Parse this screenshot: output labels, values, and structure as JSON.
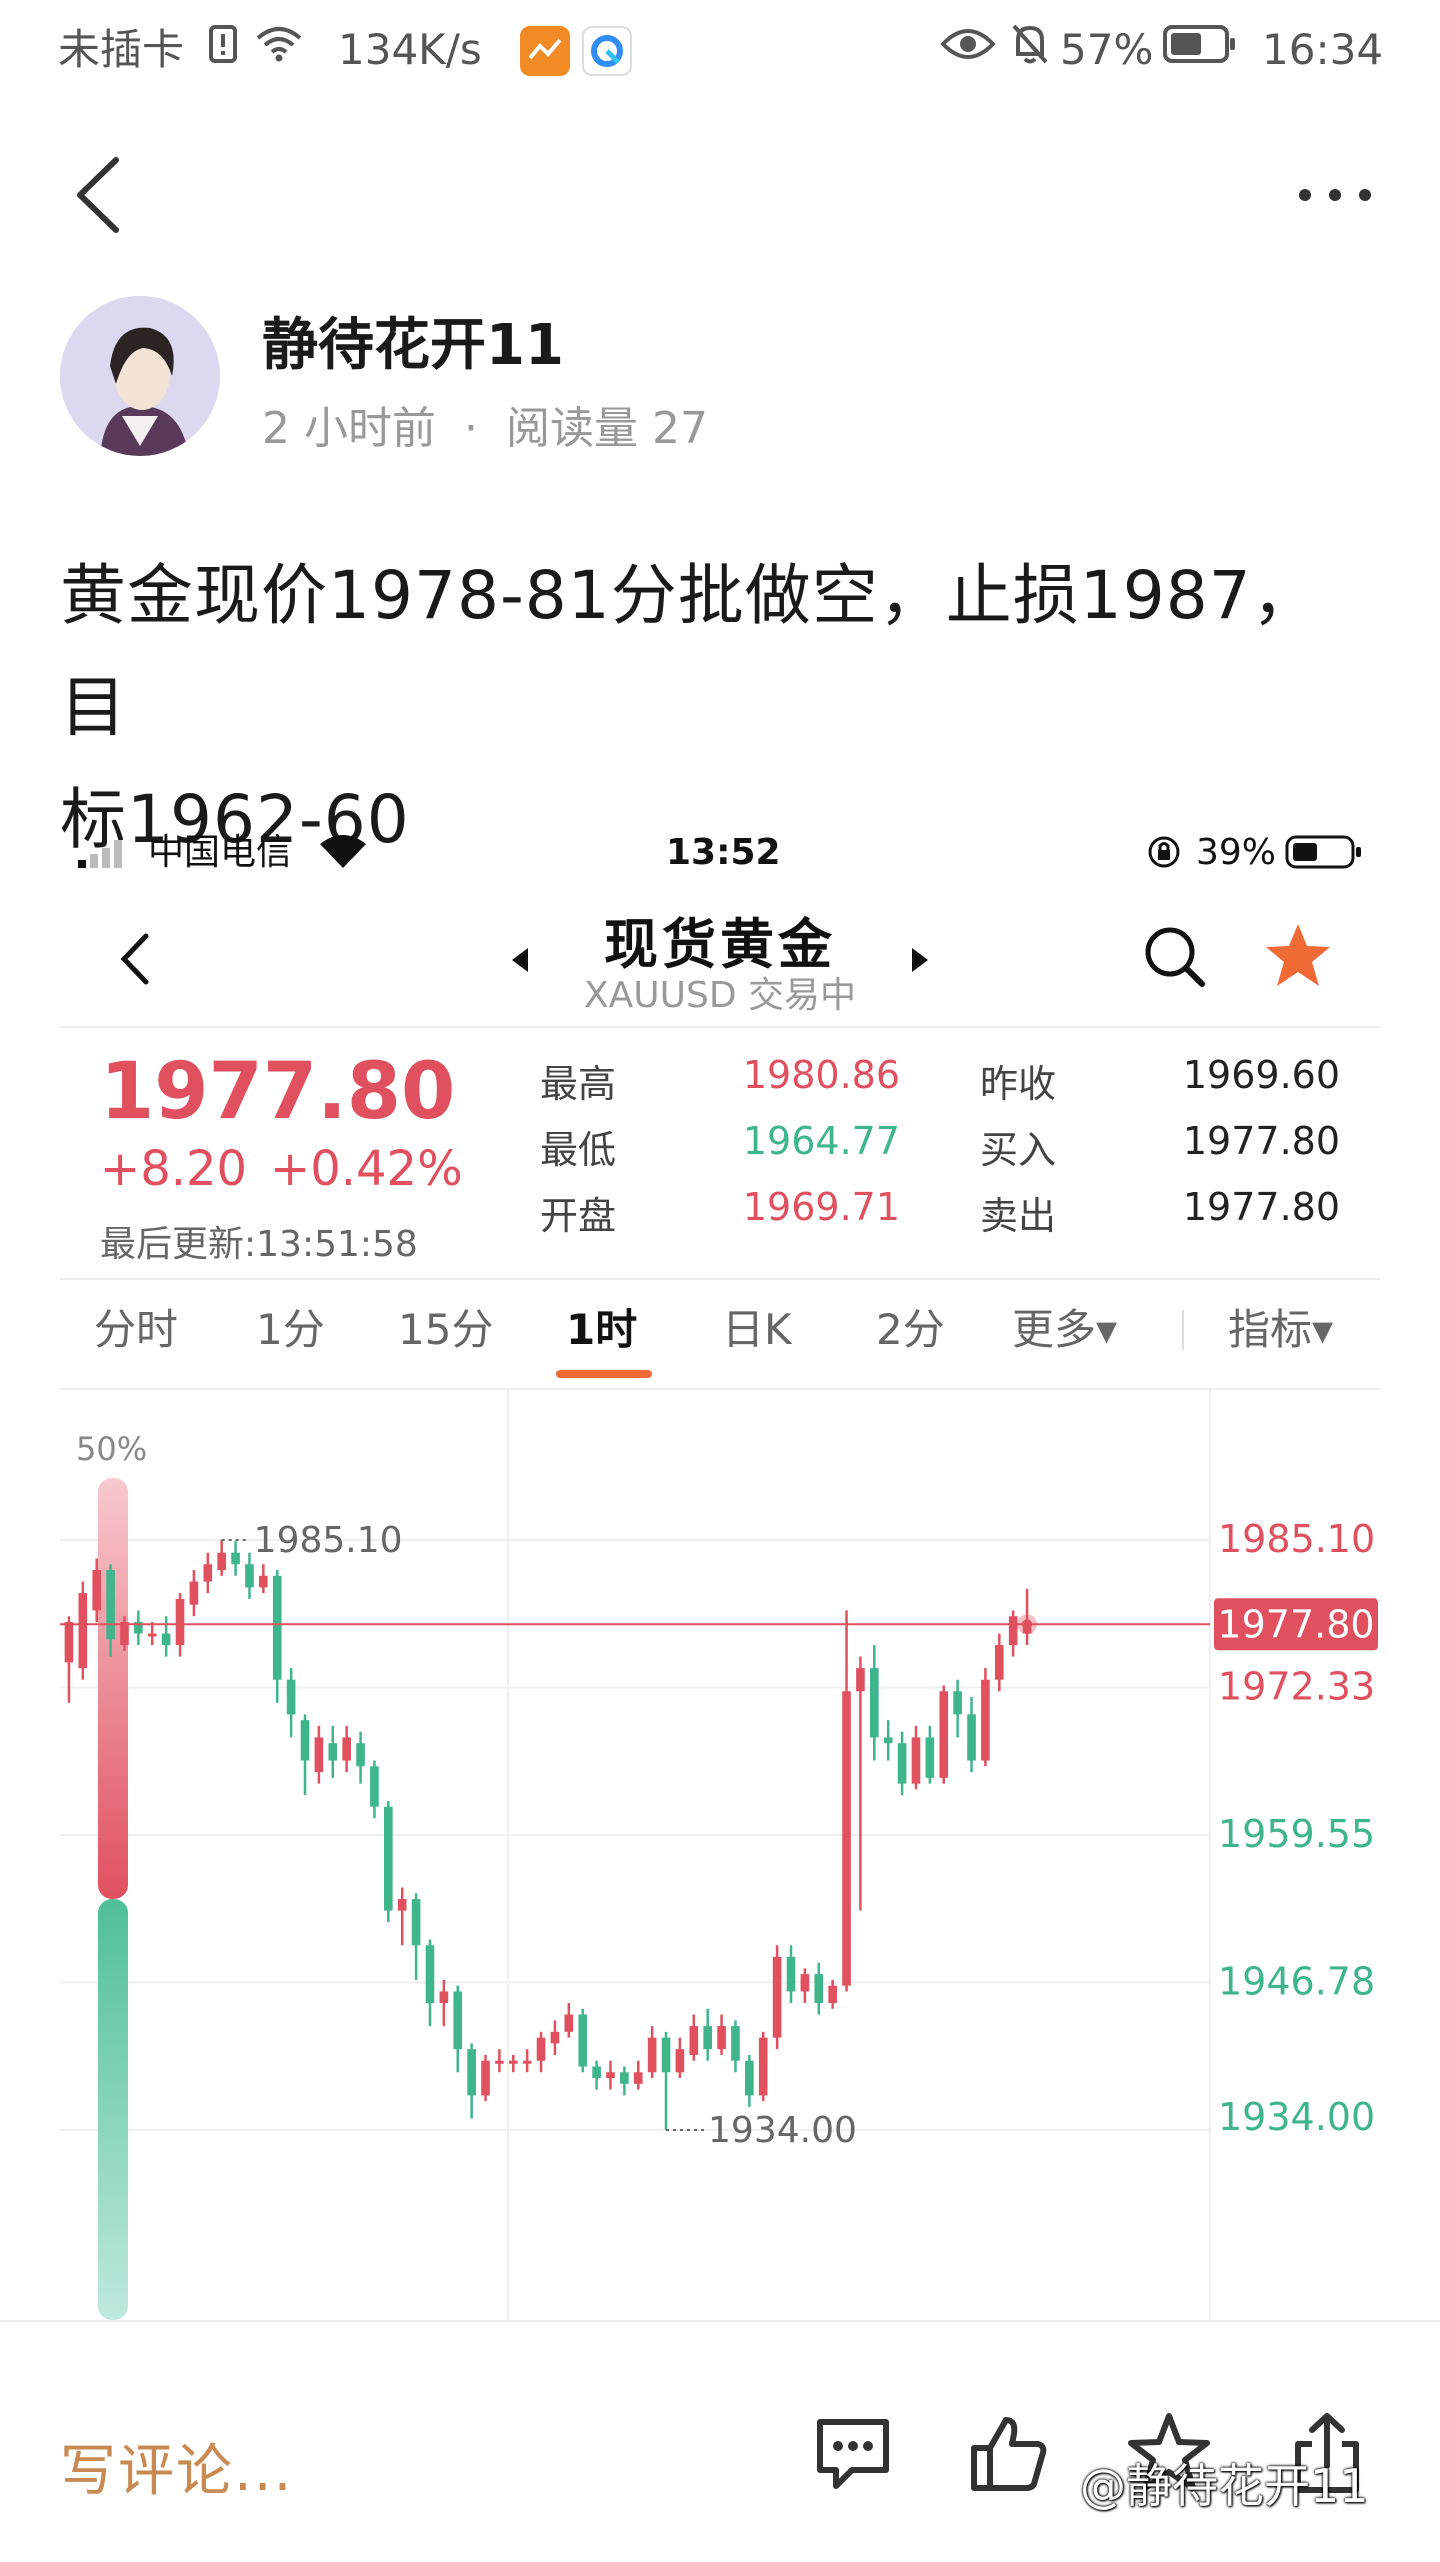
{
  "status_bar": {
    "sim": "未插卡",
    "speed": "134K/s",
    "battery": "57%",
    "time": "16:34"
  },
  "post": {
    "author": "静待花开11",
    "time_ago": "2 小时前",
    "reads": "阅读量 27",
    "line1": "黄金现价1978-81分批做空，止损1987，目",
    "line2": "标1962-60"
  },
  "screenshot": {
    "status": {
      "carrier": "中国电信",
      "time": "13:52",
      "battery": "39%"
    },
    "title": "现货黄金",
    "subtitle": "XAUUSD 交易中",
    "quote": {
      "price": "1977.80",
      "change": "+8.20",
      "change_pct": "+0.42%",
      "updated": "最后更新:13:51:58",
      "high_label": "最高",
      "high": "1980.86",
      "low_label": "最低",
      "low": "1964.77",
      "open_label": "开盘",
      "open": "1969.71",
      "prev_label": "昨收",
      "prev": "1969.60",
      "bid_label": "买入",
      "bid": "1977.80",
      "ask_label": "卖出",
      "ask": "1977.80"
    },
    "tabs": [
      "分时",
      "1分",
      "15分",
      "1时",
      "日K",
      "2分",
      "更多▾",
      "指标▾"
    ],
    "active_tab": "1时",
    "colors": {
      "up": "#e0505e",
      "down": "#3fb58c",
      "accent": "#f06a35"
    }
  },
  "chart_data": {
    "type": "candlestick",
    "symbol": "XAUUSD",
    "timeframe": "1时",
    "y_ticks": [
      "1985.10",
      "1972.33",
      "1959.55",
      "1946.78",
      "1934.00"
    ],
    "ylim": [
      1934.0,
      1985.1
    ],
    "current_price": "1977.80",
    "max_label": "1985.10",
    "min_label": "1934.00",
    "gauge_label": "50%",
    "gauge_fraction": 0.5,
    "candles": [
      [
        1974.5,
        1978.0,
        1971.0,
        1978.5
      ],
      [
        1974.0,
        1980.5,
        1973.0,
        1981.5
      ],
      [
        1979.0,
        1982.5,
        1978.0,
        1983.5
      ],
      [
        1982.5,
        1976.5,
        1975.0,
        1983.0
      ],
      [
        1976.0,
        1978.0,
        1975.5,
        1978.5
      ],
      [
        1978.0,
        1977.0,
        1976.0,
        1979.0
      ],
      [
        1977.0,
        1977.0,
        1976.0,
        1978.0
      ],
      [
        1977.0,
        1976.0,
        1975.0,
        1978.5
      ],
      [
        1976.0,
        1980.0,
        1975.0,
        1980.5
      ],
      [
        1979.5,
        1981.5,
        1978.5,
        1982.5
      ],
      [
        1981.5,
        1983.0,
        1980.5,
        1984.0
      ],
      [
        1982.5,
        1984.0,
        1982.0,
        1985.1
      ],
      [
        1984.0,
        1983.0,
        1982.0,
        1985.0
      ],
      [
        1983.0,
        1981.0,
        1980.0,
        1984.0
      ],
      [
        1981.0,
        1982.0,
        1980.5,
        1983.0
      ],
      [
        1982.0,
        1973.0,
        1971.0,
        1982.5
      ],
      [
        1973.0,
        1970.0,
        1968.0,
        1974.0
      ],
      [
        1969.5,
        1966.0,
        1963.0,
        1970.0
      ],
      [
        1965.0,
        1968.0,
        1964.0,
        1969.0
      ],
      [
        1967.5,
        1966.0,
        1964.5,
        1969.0
      ],
      [
        1966.0,
        1968.0,
        1965.0,
        1969.0
      ],
      [
        1967.5,
        1965.5,
        1964.0,
        1968.5
      ],
      [
        1965.5,
        1962.0,
        1961.0,
        1966.0
      ],
      [
        1962.0,
        1953.0,
        1952.0,
        1962.5
      ],
      [
        1953.0,
        1954.0,
        1950.0,
        1955.0
      ],
      [
        1954.0,
        1950.0,
        1947.0,
        1954.5
      ],
      [
        1950.0,
        1945.0,
        1943.0,
        1950.5
      ],
      [
        1945.0,
        1946.0,
        1943.0,
        1947.0
      ],
      [
        1946.0,
        1941.0,
        1939.0,
        1946.5
      ],
      [
        1941.0,
        1937.0,
        1935.0,
        1941.5
      ],
      [
        1937.0,
        1940.0,
        1936.5,
        1940.5
      ],
      [
        1940.0,
        1940.0,
        1939.0,
        1941.0
      ],
      [
        1940.0,
        1940.0,
        1939.0,
        1940.5
      ],
      [
        1940.0,
        1940.0,
        1939.0,
        1941.0
      ],
      [
        1940.0,
        1942.0,
        1939.0,
        1942.5
      ],
      [
        1941.5,
        1942.5,
        1940.5,
        1943.5
      ],
      [
        1942.5,
        1944.0,
        1942.0,
        1945.0
      ],
      [
        1944.0,
        1939.5,
        1939.0,
        1944.5
      ],
      [
        1939.5,
        1938.5,
        1937.5,
        1940.0
      ],
      [
        1938.5,
        1939.0,
        1937.5,
        1940.0
      ],
      [
        1939.0,
        1938.0,
        1937.0,
        1939.5
      ],
      [
        1938.0,
        1939.0,
        1937.5,
        1940.0
      ],
      [
        1939.0,
        1942.0,
        1938.5,
        1943.0
      ],
      [
        1942.0,
        1939.0,
        1934.0,
        1942.5
      ],
      [
        1939.0,
        1941.0,
        1938.5,
        1942.0
      ],
      [
        1940.5,
        1943.0,
        1940.0,
        1944.0
      ],
      [
        1943.0,
        1941.0,
        1940.0,
        1944.5
      ],
      [
        1941.0,
        1943.0,
        1940.5,
        1944.0
      ],
      [
        1943.0,
        1940.0,
        1939.0,
        1943.5
      ],
      [
        1940.0,
        1937.0,
        1936.0,
        1940.5
      ],
      [
        1937.0,
        1942.0,
        1936.5,
        1942.5
      ],
      [
        1942.0,
        1949.0,
        1941.0,
        1950.0
      ],
      [
        1949.0,
        1946.0,
        1945.0,
        1950.0
      ],
      [
        1946.0,
        1947.5,
        1945.0,
        1948.0
      ],
      [
        1947.5,
        1945.0,
        1944.0,
        1948.5
      ],
      [
        1945.0,
        1946.5,
        1944.5,
        1947.0
      ],
      [
        1946.5,
        1972.0,
        1946.0,
        1979.0
      ],
      [
        1972.0,
        1974.0,
        1953.0,
        1975.0
      ],
      [
        1974.0,
        1968.0,
        1966.0,
        1976.0
      ],
      [
        1968.0,
        1967.5,
        1966.0,
        1969.5
      ],
      [
        1967.5,
        1964.0,
        1963.0,
        1968.5
      ],
      [
        1964.0,
        1968.0,
        1963.5,
        1969.0
      ],
      [
        1968.0,
        1964.5,
        1964.0,
        1969.0
      ],
      [
        1964.5,
        1972.0,
        1964.0,
        1972.5
      ],
      [
        1972.0,
        1970.0,
        1968.0,
        1973.0
      ],
      [
        1970.0,
        1966.0,
        1965.0,
        1971.5
      ],
      [
        1966.0,
        1973.0,
        1965.5,
        1974.0
      ],
      [
        1973.0,
        1976.0,
        1972.0,
        1977.0
      ],
      [
        1976.0,
        1978.5,
        1975.0,
        1979.0
      ],
      [
        1977.0,
        1977.8,
        1976.0,
        1980.86
      ]
    ]
  }
}
